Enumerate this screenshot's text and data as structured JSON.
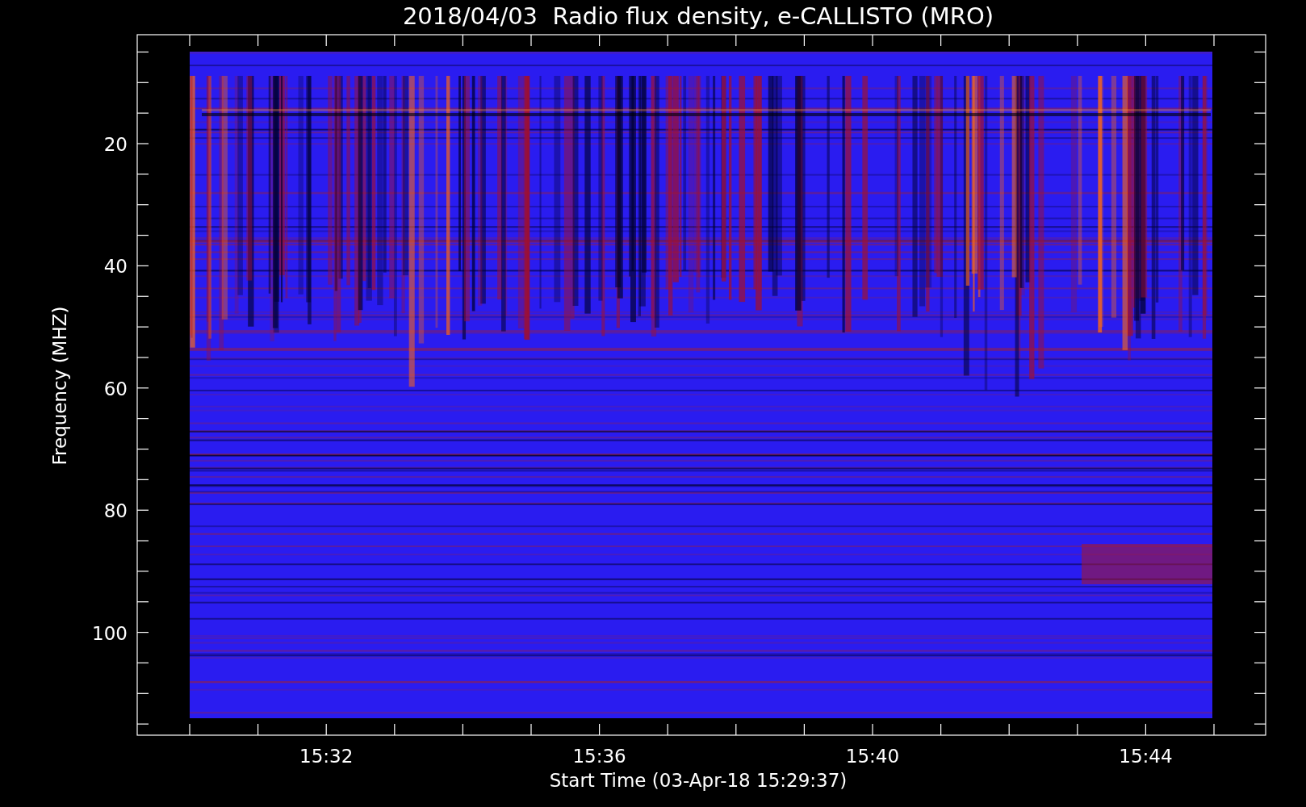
{
  "title": "2018/04/03  Radio flux density, e-CALLISTO (MRO)",
  "y_axis": {
    "label": "Frequency (MHZ)",
    "ticks": [
      "20",
      "40",
      "60",
      "80",
      "100"
    ]
  },
  "x_axis": {
    "label": "Start Time (03-Apr-18 15:29:37)",
    "ticks": [
      "15:32",
      "15:36",
      "15:40",
      "15:44"
    ]
  }
}
